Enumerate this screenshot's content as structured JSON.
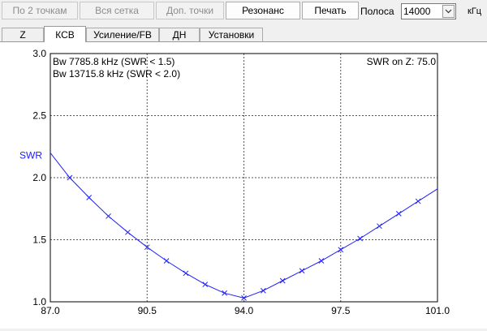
{
  "toolbar": {
    "by_two_points": "По 2 точкам",
    "whole_grid": "Вся сетка",
    "extra_points": "Доп. точки",
    "resonance": "Резонанс",
    "print": "Печать",
    "band_label": "Полоса",
    "band_value": "14000",
    "band_unit": "кГц"
  },
  "tabs": [
    {
      "label": "Z"
    },
    {
      "label": "КСВ"
    },
    {
      "label": "Усиление/FB"
    },
    {
      "label": "ДН"
    },
    {
      "label": "Установки"
    }
  ],
  "chart_data": {
    "type": "line",
    "ylabel": "SWR",
    "xlim": [
      87.0,
      101.0
    ],
    "ylim": [
      1.0,
      3.0
    ],
    "x_ticks": [
      "87.0",
      "90.5",
      "94.0",
      "97.5",
      "101.0"
    ],
    "y_ticks": [
      "1.0",
      "1.5",
      "2.0",
      "2.5",
      "3.0"
    ],
    "annotations": {
      "bw1": "Bw 7785.8 kHz (SWR < 1.5)",
      "bw2": "Bw 13715.8 kHz (SWR < 2.0)",
      "swr_on_z": "SWR on Z: 75.0"
    },
    "series_color": "#2020ff",
    "x": [
      87.0,
      87.7,
      88.4,
      89.1,
      89.8,
      90.5,
      91.2,
      91.9,
      92.6,
      93.3,
      94.0,
      94.7,
      95.4,
      96.1,
      96.8,
      97.5,
      98.2,
      98.9,
      99.6,
      100.3,
      101.0
    ],
    "values": [
      2.2,
      2.0,
      1.84,
      1.69,
      1.56,
      1.44,
      1.33,
      1.23,
      1.14,
      1.07,
      1.03,
      1.09,
      1.17,
      1.25,
      1.33,
      1.42,
      1.51,
      1.61,
      1.71,
      1.81,
      1.91
    ],
    "markers": [
      [
        87.7,
        2.0
      ],
      [
        88.4,
        1.84
      ],
      [
        89.1,
        1.69
      ],
      [
        89.8,
        1.56
      ],
      [
        90.5,
        1.44
      ],
      [
        91.2,
        1.33
      ],
      [
        91.9,
        1.23
      ],
      [
        92.6,
        1.14
      ],
      [
        93.3,
        1.07
      ],
      [
        94.0,
        1.03
      ],
      [
        94.7,
        1.09
      ],
      [
        95.4,
        1.17
      ],
      [
        96.1,
        1.25
      ],
      [
        96.8,
        1.33
      ],
      [
        97.5,
        1.42
      ],
      [
        98.2,
        1.51
      ],
      [
        98.9,
        1.61
      ],
      [
        99.6,
        1.71
      ],
      [
        100.3,
        1.81
      ]
    ]
  }
}
